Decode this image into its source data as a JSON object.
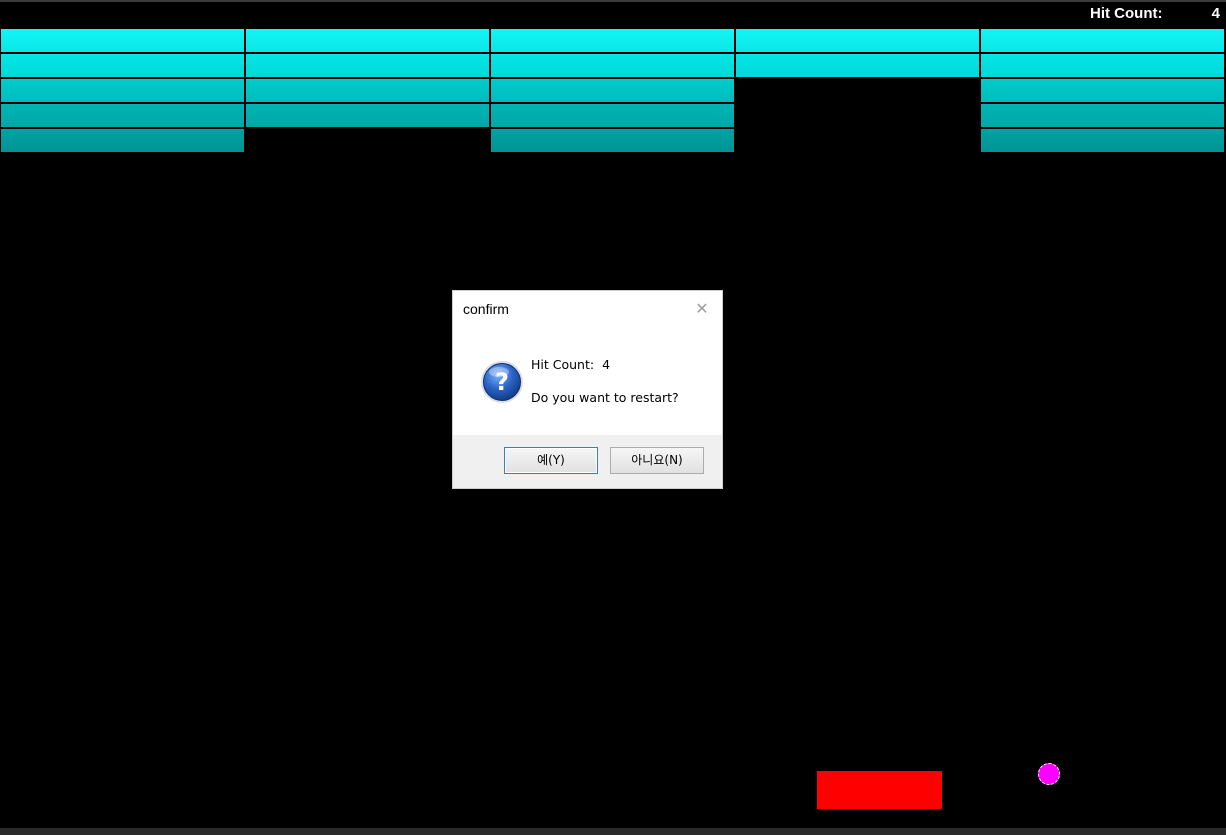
{
  "hud": {
    "hit_label": "Hit Count:",
    "hit_value": "4"
  },
  "bricks": {
    "rows": 5,
    "columns": 5,
    "present": [
      [
        true,
        true,
        true,
        true,
        true
      ],
      [
        true,
        true,
        true,
        true,
        true
      ],
      [
        true,
        true,
        true,
        false,
        true
      ],
      [
        true,
        true,
        true,
        false,
        true
      ],
      [
        true,
        false,
        true,
        false,
        true
      ]
    ],
    "colors": [
      "#0ae6e6",
      "#00d8d8",
      "#00bcbc",
      "#00a8a8",
      "#009494"
    ]
  },
  "paddle": {
    "color": "#ff0000"
  },
  "ball": {
    "color": "#ff00ff"
  },
  "dialog": {
    "title": "confirm",
    "close_symbol": "✕",
    "icon": "question-icon",
    "message_line1_label": "Hit Count:",
    "message_line1_value": "4",
    "message_line2": "Do you want to restart?",
    "yes_label": "예(Y)",
    "no_label": "아니요(N)"
  }
}
